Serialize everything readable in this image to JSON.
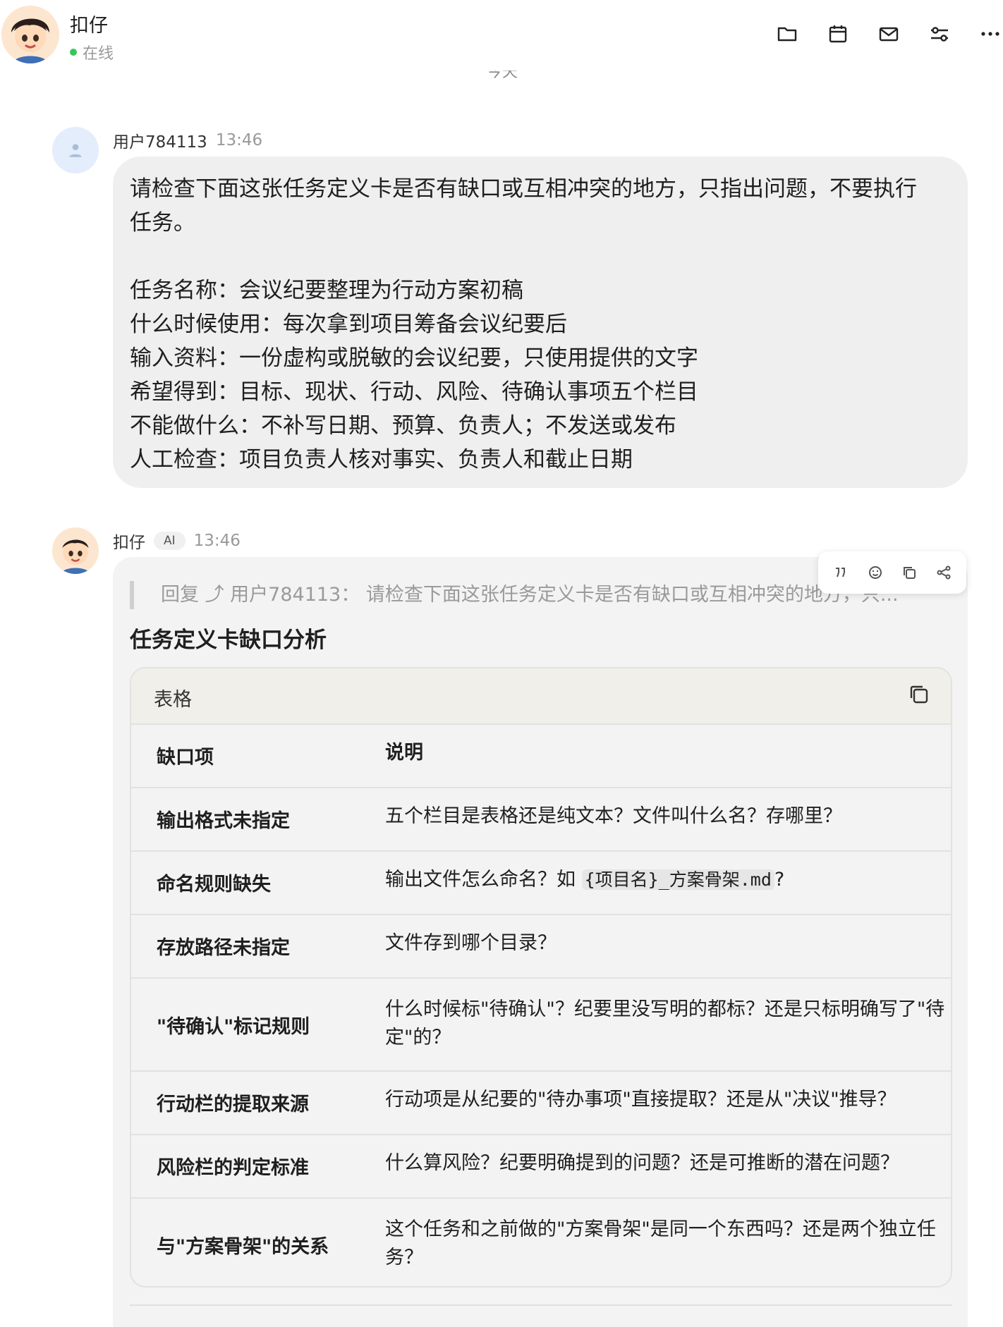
{
  "header": {
    "agent_name": "扣仔",
    "status": "在线",
    "status_color": "#34c759",
    "tools": [
      "folder-icon",
      "calendar-icon",
      "mail-icon",
      "settings-icon",
      "more-icon"
    ]
  },
  "day_divider": "今天",
  "user_message": {
    "sender": "用户784113",
    "time": "13:46",
    "lines": [
      "请检查下面这张任务定义卡是否有缺口或互相冲突的地方，只指出问题，不要执行",
      "任务。",
      "",
      "任务名称：会议纪要整理为行动方案初稿",
      "什么时候使用：每次拿到项目筹备会议纪要后",
      "输入资料：一份虚构或脱敏的会议纪要，只使用提供的文字",
      "希望得到：目标、现状、行动、风险、待确认事项五个栏目",
      "不能做什么：不补写日期、预算、负责人；不发送或发布",
      "人工检查：项目负责人核对事实、负责人和截止日期"
    ]
  },
  "ai_message": {
    "sender": "扣仔",
    "badge": "AI",
    "time": "13:46",
    "quote": "回复 ⤴ 用户784113：  请检查下面这张任务定义卡是否有缺口或互相冲突的地方，只...",
    "title": "任务定义卡缺口分析",
    "table_label": "表格",
    "table_headers": [
      "缺口项",
      "说明"
    ],
    "rows": [
      {
        "item": "输出格式未指定",
        "desc": "五个栏目是表格还是纯文本？文件叫什么名？存哪里？"
      },
      {
        "item": "命名规则缺失",
        "desc_pre": "输出文件怎么命名？如 ",
        "desc_code": "{项目名}_方案骨架.md",
        "desc_post": "?"
      },
      {
        "item": "存放路径未指定",
        "desc": "文件存到哪个目录？"
      },
      {
        "item": "\"待确认\"标记规则",
        "desc": "什么时候标\"待确认\"？纪要里没写明的都标？还是只标明确写了\"待定\"的？"
      },
      {
        "item": "行动栏的提取来源",
        "desc": "行动项是从纪要的\"待办事项\"直接提取？还是从\"决议\"推导？"
      },
      {
        "item": "风险栏的判定标准",
        "desc": "什么算风险？纪要明确提到的问题？还是可推断的潜在问题？"
      },
      {
        "item": "与\"方案骨架\"的关系",
        "desc": "这个任务和之前做的\"方案骨架\"是同一个东西吗？还是两个独立任务？"
      }
    ]
  }
}
